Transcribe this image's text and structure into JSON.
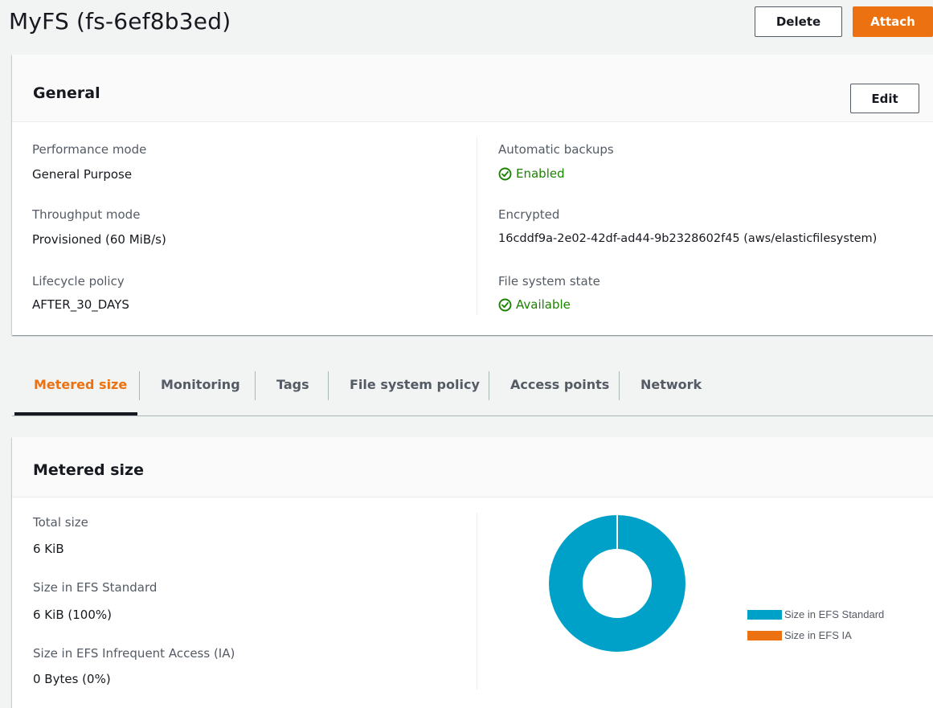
{
  "header": {
    "title": "MyFS (fs-6ef8b3ed)",
    "delete_label": "Delete",
    "attach_label": "Attach"
  },
  "general": {
    "title": "General",
    "edit_label": "Edit",
    "performance_mode_label": "Performance mode",
    "performance_mode_value": "General Purpose",
    "throughput_mode_label": "Throughput mode",
    "throughput_mode_value": "Provisioned (60 MiB/s)",
    "lifecycle_policy_label": "Lifecycle policy",
    "lifecycle_policy_value": "AFTER_30_DAYS",
    "automatic_backups_label": "Automatic backups",
    "automatic_backups_value": "Enabled",
    "encrypted_label": "Encrypted",
    "encrypted_value": "16cddf9a-2e02-42df-ad44-9b2328602f45 (aws/elasticfilesystem)",
    "file_system_state_label": "File system state",
    "file_system_state_value": "Available"
  },
  "tabs": [
    {
      "label": "Metered size",
      "active": true
    },
    {
      "label": "Monitoring",
      "active": false
    },
    {
      "label": "Tags",
      "active": false
    },
    {
      "label": "File system policy",
      "active": false
    },
    {
      "label": "Access points",
      "active": false
    },
    {
      "label": "Network",
      "active": false
    }
  ],
  "metered": {
    "title": "Metered size",
    "total_size_label": "Total size",
    "total_size_value": "6 KiB",
    "standard_label": "Size in EFS Standard",
    "standard_value": "6 KiB (100%)",
    "ia_label": "Size in EFS Infrequent Access (IA)",
    "ia_value": "0 Bytes (0%)"
  },
  "chart_data": {
    "type": "pie",
    "categories": [
      "Size in EFS Standard",
      "Size in EFS IA"
    ],
    "values": [
      100,
      0
    ],
    "colors": [
      "#00a1c9",
      "#ec7211"
    ],
    "donut": true,
    "legend": "right"
  },
  "colors": {
    "accent": "#ec7211",
    "success": "#1d8102",
    "standard": "#00a1c9"
  },
  "icons": {
    "status_ok": "status-positive-icon"
  }
}
